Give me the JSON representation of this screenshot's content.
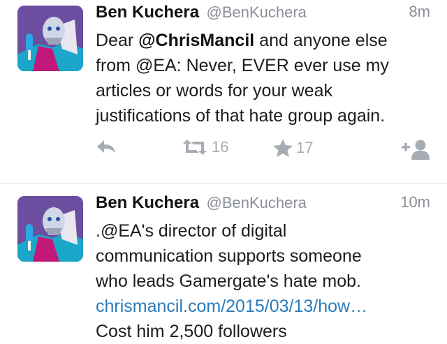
{
  "tweets": [
    {
      "author_name": "Ben Kuchera",
      "author_handle": "@BenKuchera",
      "time": "8m",
      "text_lines": [
        {
          "before": "Dear ",
          "mention": "@ChrisMancil",
          "after": " and anyone else"
        },
        {
          "text": "from @EA: Never, EVER ever use my"
        },
        {
          "text": "articles or words for your weak"
        },
        {
          "text": "justifications of that hate group again."
        }
      ],
      "retweets": "16",
      "favorites": "17"
    },
    {
      "author_name": "Ben Kuchera",
      "author_handle": "@BenKuchera",
      "time": "10m",
      "text_lines": [
        {
          "text": ".@EA's director of digital"
        },
        {
          "text": "communication supports someone"
        },
        {
          "text": "who leads Gamergate's hate mob."
        }
      ],
      "link": "chrismancil.com/2015/03/13/how…",
      "text_after_link": "Cost him 2,500 followers"
    }
  ],
  "colors": {
    "link": "#2b7bb9",
    "meta_gray": "#8a8f96",
    "action_gray": "#a5acb4",
    "divider": "#d9dde1"
  },
  "icons": [
    "avatar-image",
    "reply-icon",
    "retweet-icon",
    "favorite-star-icon",
    "follow-icon"
  ]
}
